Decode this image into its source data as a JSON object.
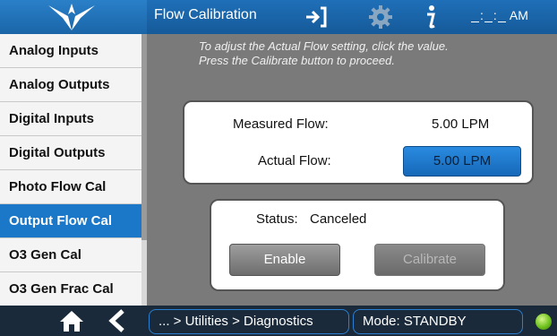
{
  "header": {
    "title": "Flow Calibration",
    "clock": {
      "hours": "",
      "minutes": "",
      "ampm": "AM"
    }
  },
  "icons": {
    "logo": "trident-logo-icon",
    "exit": "exit-icon",
    "settings": "gear-icon",
    "info": "info-icon",
    "home": "home-icon",
    "back": "back-chevron-icon"
  },
  "sidebar": {
    "items": [
      {
        "label": "Analog Inputs",
        "active": false
      },
      {
        "label": "Analog Outputs",
        "active": false
      },
      {
        "label": "Digital Inputs",
        "active": false
      },
      {
        "label": "Digital Outputs",
        "active": false
      },
      {
        "label": "Photo Flow Cal",
        "active": false
      },
      {
        "label": "Output Flow Cal",
        "active": true
      },
      {
        "label": "O3 Gen Cal",
        "active": false
      },
      {
        "label": "O3 Gen Frac Cal",
        "active": false
      }
    ]
  },
  "main": {
    "instructions": {
      "line1": "To adjust the Actual Flow setting, click the value.",
      "line2": "Press the Calibrate button to proceed."
    },
    "measured_flow_label": "Measured Flow:",
    "measured_flow_value": "5.00 LPM",
    "actual_flow_label": "Actual Flow:",
    "actual_flow_value": "5.00 LPM",
    "status_label": "Status:",
    "status_value": "Canceled",
    "enable_label": "Enable",
    "calibrate_label": "Calibrate"
  },
  "footer": {
    "breadcrumb": "... > Utilities > Diagnostics",
    "mode": "Mode: STANDBY"
  },
  "colors": {
    "accent": "#1b78c8",
    "topbar": "#1a65a8",
    "panel_bg": "#7a7a7a",
    "status_led": "#6fc21e"
  }
}
